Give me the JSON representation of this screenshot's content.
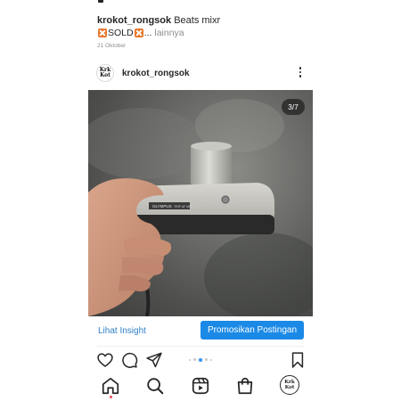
{
  "caption": {
    "username": "krokot_rongsok",
    "text": "Beats mixr",
    "sold_label": "SOLD",
    "ellipsis": "...",
    "more_label": "lainnya",
    "date": "21 Oktober"
  },
  "post": {
    "username": "krokot_rongsok",
    "avatar_text_line1": "Krk",
    "avatar_text_line2": "Kot",
    "photo_counter": "3/7",
    "photo_brand_text": "OLYMPUS",
    "photo_model_text": "TRIP AF MINI",
    "carousel_total": 5,
    "carousel_active": 3
  },
  "insights": {
    "link_label": "Lihat Insight",
    "promote_label": "Promosikan Postingan"
  },
  "colors": {
    "link": "#2f7fc8",
    "promote_button": "#1b8ae6",
    "sold_badge": "#e8762b",
    "active_dot": "#3897f0"
  },
  "icons": {
    "actions": [
      "heart-icon",
      "comment-icon",
      "share-icon",
      "bookmark-icon"
    ],
    "nav": [
      "home-icon",
      "search-icon",
      "reels-icon",
      "shop-icon",
      "profile-avatar"
    ]
  }
}
